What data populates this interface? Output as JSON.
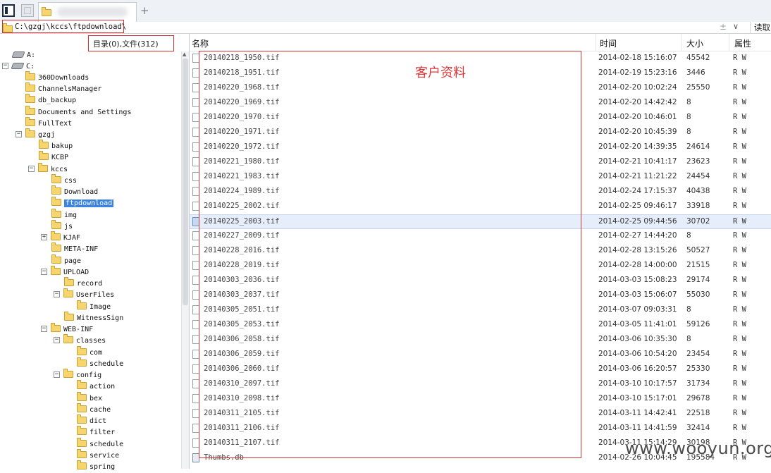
{
  "tabs": {
    "add_label": "+"
  },
  "path": {
    "current": "C:\\gzgj\\kccs\\ftpdownload\\",
    "plusminus": "±",
    "dropdown_arrow": "∨",
    "read_label": "读取"
  },
  "tree": {
    "dir_count": "目录(0),文件(312)",
    "items": [
      {
        "label": "A:"
      },
      {
        "label": "C:"
      },
      {
        "label": "360Downloads"
      },
      {
        "label": "ChannelsManager"
      },
      {
        "label": "db_backup"
      },
      {
        "label": "Documents and Settings"
      },
      {
        "label": "FullText"
      },
      {
        "label": "gzgj"
      },
      {
        "label": "bakup"
      },
      {
        "label": "KCBP"
      },
      {
        "label": "kccs"
      },
      {
        "label": "css"
      },
      {
        "label": "Download"
      },
      {
        "label": "ftpdownload"
      },
      {
        "label": "img"
      },
      {
        "label": "js"
      },
      {
        "label": "KJAF"
      },
      {
        "label": "META-INF"
      },
      {
        "label": "page"
      },
      {
        "label": "UPLOAD"
      },
      {
        "label": "record"
      },
      {
        "label": "UserFiles"
      },
      {
        "label": "Image"
      },
      {
        "label": "WitnessSign"
      },
      {
        "label": "WEB-INF"
      },
      {
        "label": "classes"
      },
      {
        "label": "com"
      },
      {
        "label": "schedule"
      },
      {
        "label": "config"
      },
      {
        "label": "action"
      },
      {
        "label": "bex"
      },
      {
        "label": "cache"
      },
      {
        "label": "dict"
      },
      {
        "label": "filter"
      },
      {
        "label": "schedule"
      },
      {
        "label": "service"
      },
      {
        "label": "spring"
      }
    ]
  },
  "list": {
    "columns": {
      "name": "名称",
      "time": "时间",
      "size": "大小",
      "attr": "属性"
    },
    "files": [
      {
        "name": "20140218_1950.tif",
        "time": "2014-02-18 15:16:07",
        "size": "45542",
        "attr": "R W"
      },
      {
        "name": "20140218_1951.tif",
        "time": "2014-02-19 15:23:16",
        "size": "3446",
        "attr": "R W"
      },
      {
        "name": "20140220_1968.tif",
        "time": "2014-02-20 10:02:24",
        "size": "25550",
        "attr": "R W"
      },
      {
        "name": "20140220_1969.tif",
        "time": "2014-02-20 14:42:42",
        "size": "8",
        "attr": "R W"
      },
      {
        "name": "20140220_1970.tif",
        "time": "2014-02-20 10:46:01",
        "size": "8",
        "attr": "R W"
      },
      {
        "name": "20140220_1971.tif",
        "time": "2014-02-20 10:45:39",
        "size": "8",
        "attr": "R W"
      },
      {
        "name": "20140220_1972.tif",
        "time": "2014-02-20 14:39:35",
        "size": "24614",
        "attr": "R W"
      },
      {
        "name": "20140221_1980.tif",
        "time": "2014-02-21 10:41:17",
        "size": "23623",
        "attr": "R W"
      },
      {
        "name": "20140221_1983.tif",
        "time": "2014-02-21 11:21:22",
        "size": "24454",
        "attr": "R W"
      },
      {
        "name": "20140224_1989.tif",
        "time": "2014-02-24 17:15:37",
        "size": "40438",
        "attr": "R W"
      },
      {
        "name": "20140225_2002.tif",
        "time": "2014-02-25 09:46:17",
        "size": "33918",
        "attr": "R W"
      },
      {
        "name": "20140225_2003.tif",
        "time": "2014-02-25 09:44:56",
        "size": "30702",
        "attr": "R W"
      },
      {
        "name": "20140227_2009.tif",
        "time": "2014-02-27 14:44:20",
        "size": "8",
        "attr": "R W"
      },
      {
        "name": "20140228_2016.tif",
        "time": "2014-02-28 13:15:26",
        "size": "50527",
        "attr": "R W"
      },
      {
        "name": "20140228_2019.tif",
        "time": "2014-02-28 14:00:00",
        "size": "21515",
        "attr": "R W"
      },
      {
        "name": "20140303_2036.tif",
        "time": "2014-03-03 15:08:23",
        "size": "29174",
        "attr": "R W"
      },
      {
        "name": "20140303_2037.tif",
        "time": "2014-03-03 15:06:07",
        "size": "55030",
        "attr": "R W"
      },
      {
        "name": "20140305_2051.tif",
        "time": "2014-03-07 09:03:31",
        "size": "8",
        "attr": "R W"
      },
      {
        "name": "20140305_2053.tif",
        "time": "2014-03-05 11:41:01",
        "size": "59126",
        "attr": "R W"
      },
      {
        "name": "20140306_2058.tif",
        "time": "2014-03-06 10:35:30",
        "size": "8",
        "attr": "R W"
      },
      {
        "name": "20140306_2059.tif",
        "time": "2014-03-06 10:54:20",
        "size": "23454",
        "attr": "R W"
      },
      {
        "name": "20140306_2060.tif",
        "time": "2014-03-06 16:20:57",
        "size": "25330",
        "attr": "R W"
      },
      {
        "name": "20140310_2097.tif",
        "time": "2014-03-10 10:17:57",
        "size": "31734",
        "attr": "R W"
      },
      {
        "name": "20140310_2098.tif",
        "time": "2014-03-10 15:17:01",
        "size": "29678",
        "attr": "R W"
      },
      {
        "name": "20140311_2105.tif",
        "time": "2014-03-11 14:42:41",
        "size": "22518",
        "attr": "R W"
      },
      {
        "name": "20140311_2106.tif",
        "time": "2014-03-11 14:41:59",
        "size": "32414",
        "attr": "R W"
      },
      {
        "name": "20140311_2107.tif",
        "time": "2014-03-11 15:14:29",
        "size": "30198",
        "attr": "R W"
      },
      {
        "name": "Thumbs.db",
        "time": "2014-02-26 10:04:45",
        "size": "195584",
        "attr": "R W"
      }
    ]
  },
  "annotation": "客户资料",
  "watermark": "www.wooyun.org",
  "colors": {
    "annotation": "#e03838",
    "selection": "#3a83e0"
  }
}
